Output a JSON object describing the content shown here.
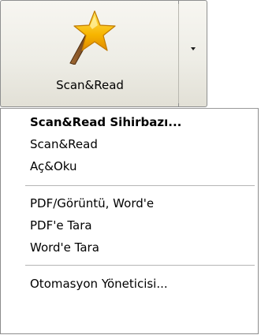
{
  "button": {
    "label": "Scan&Read",
    "icon": "wand-icon"
  },
  "menu": {
    "items": [
      {
        "label": "Scan&Read Sihirbazı...",
        "bold": true
      },
      {
        "label": "Scan&Read"
      },
      {
        "label": "Aç&Oku"
      },
      {
        "label": "PDF/Görüntü, Word'e"
      },
      {
        "label": "PDF'e Tara"
      },
      {
        "label": "Word'e Tara"
      },
      {
        "label": "Otomasyon Yöneticisi..."
      }
    ]
  },
  "colors": {
    "star": "#f5b800",
    "wand": "#8a5a2b",
    "border": "#8e8f8f"
  }
}
